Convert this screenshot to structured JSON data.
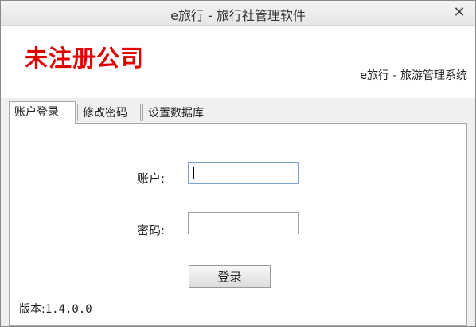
{
  "window": {
    "title": "e旅行 - 旅行社管理软件",
    "close_label": "✕"
  },
  "header": {
    "company": "未注册公司",
    "subtitle": "e旅行 - 旅游管理系统",
    "company_color": "#e10000"
  },
  "tabs": [
    {
      "label": "账户登录",
      "active": true
    },
    {
      "label": "修改密码",
      "active": false
    },
    {
      "label": "设置数据库",
      "active": false
    }
  ],
  "login_form": {
    "account_label": "账户:",
    "account_value": "",
    "password_label": "密码:",
    "password_value": "",
    "login_button": "登录"
  },
  "footer": {
    "version_label": "版本:",
    "version_value": "1.4.0.0"
  }
}
